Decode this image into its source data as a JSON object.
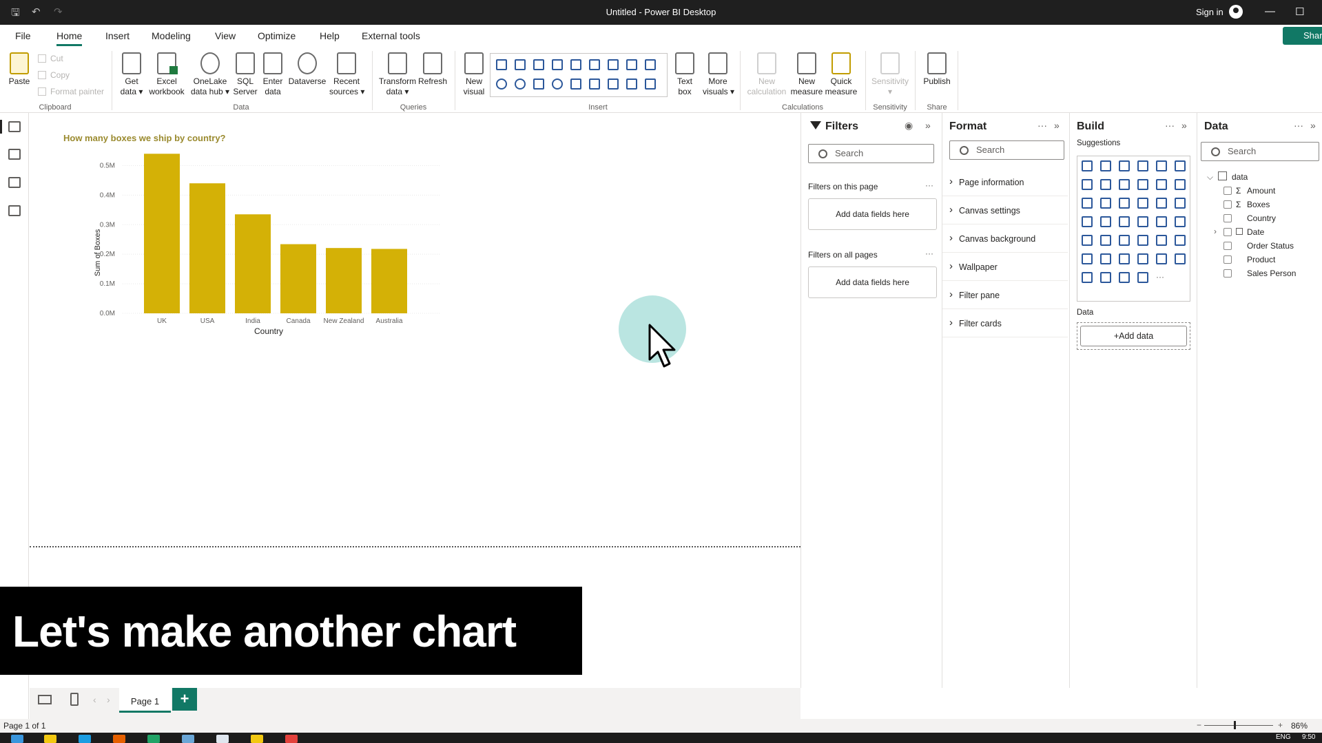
{
  "window": {
    "title": "Untitled - Power BI Desktop",
    "sign_in": "Sign in"
  },
  "menu": {
    "tabs": [
      "File",
      "Home",
      "Insert",
      "Modeling",
      "View",
      "Optimize",
      "Help",
      "External tools"
    ],
    "active": "Home",
    "share": "Share"
  },
  "ribbon": {
    "paste": "Paste",
    "cut": "Cut",
    "copy": "Copy",
    "format_painter": "Format painter",
    "get_data": "Get\ndata ▾",
    "excel": "Excel\nworkbook",
    "onelake": "OneLake\ndata hub ▾",
    "sql": "SQL\nServer",
    "enter_data": "Enter\ndata",
    "dataverse": "Dataverse",
    "recent": "Recent\nsources ▾",
    "transform": "Transform\ndata ▾",
    "refresh": "Refresh",
    "new_visual": "New\nvisual",
    "text_box": "Text\nbox",
    "more_visuals": "More\nvisuals ▾",
    "new_calc": "New\ncalculation",
    "new_measure": "New\nmeasure",
    "quick_measure": "Quick\nmeasure",
    "sensitivity": "Sensitivity\n▾",
    "publish": "Publish",
    "groups": {
      "clipboard": "Clipboard",
      "data": "Data",
      "queries": "Queries",
      "insert": "Insert",
      "calculations": "Calculations",
      "sensitivity": "Sensitivity",
      "share": "Share"
    }
  },
  "caption": "Let's make another chart",
  "pages": {
    "tab": "Page 1",
    "add": "+"
  },
  "status": {
    "page": "Page 1 of 1",
    "zoom": "86%",
    "lang": "ENG",
    "time": "9:50"
  },
  "filters": {
    "title": "Filters",
    "search": "Search",
    "on_page": "Filters on this page",
    "on_all": "Filters on all pages",
    "add_fields": "Add data fields here",
    "more": "···"
  },
  "format": {
    "title": "Format",
    "search": "Search",
    "sections": [
      "Page information",
      "Canvas settings",
      "Canvas background",
      "Wallpaper",
      "Filter pane",
      "Filter cards"
    ]
  },
  "build": {
    "title": "Build",
    "suggestions": "Suggestions",
    "data_label": "Data",
    "add_data": "+Add data"
  },
  "data_pane": {
    "title": "Data",
    "search": "Search",
    "table": "data",
    "fields": [
      {
        "name": "Amount",
        "sigma": true
      },
      {
        "name": "Boxes",
        "sigma": true
      },
      {
        "name": "Country",
        "sigma": false
      },
      {
        "name": "Date",
        "sigma": false
      },
      {
        "name": "Order Status",
        "sigma": false
      },
      {
        "name": "Product",
        "sigma": false
      },
      {
        "name": "Sales Person",
        "sigma": false
      }
    ]
  },
  "chart_data": {
    "type": "bar",
    "title": "How many boxes we ship by country?",
    "xlabel": "Country",
    "ylabel": "Sum of Boxes",
    "categories": [
      "UK",
      "USA",
      "India",
      "Canada",
      "New Zealand",
      "Australia"
    ],
    "values": [
      0.54,
      0.44,
      0.335,
      0.234,
      0.221,
      0.218
    ],
    "unit": "M",
    "ylim": [
      0,
      0.55
    ],
    "yticks": [
      "0.0M",
      "0.1M",
      "0.2M",
      "0.3M",
      "0.4M",
      "0.5M"
    ],
    "bar_color": "#D4B106",
    "grid": true
  }
}
